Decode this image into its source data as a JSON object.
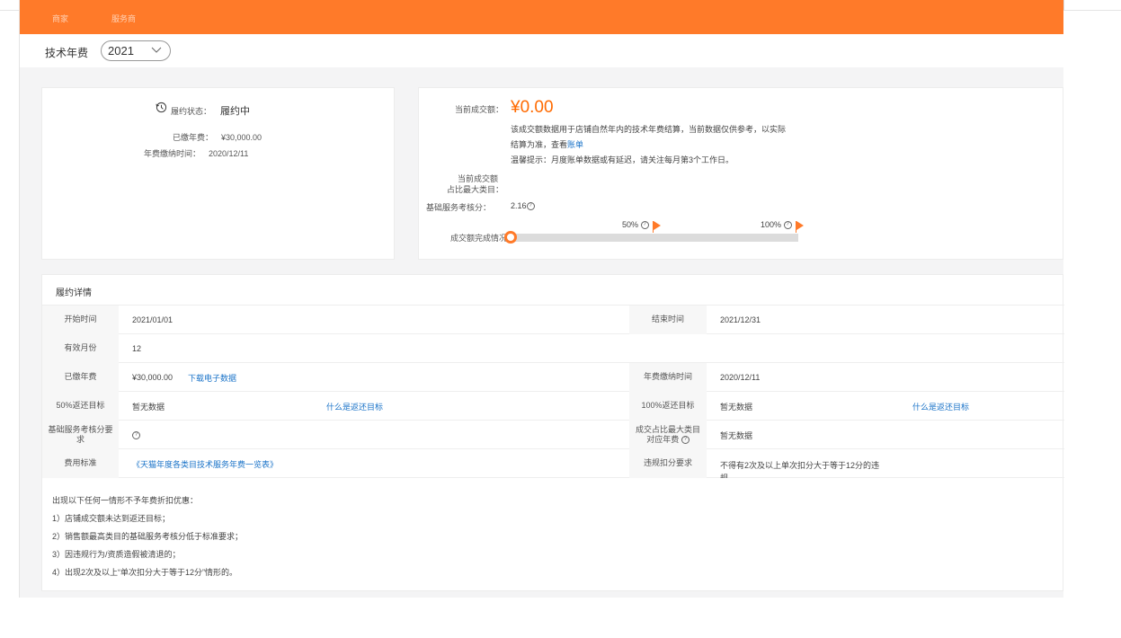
{
  "nav": {
    "item1": "商家",
    "item2": "服务商"
  },
  "title": "技术年费",
  "year_select": {
    "value": "2021"
  },
  "summary": {
    "state_label": "履约状态：",
    "state_value": "履约中",
    "paid_label": "已缴年费：",
    "paid_value": "¥30,000.00",
    "paid_time_label": "年费缴纳时间：",
    "paid_time_value": "2020/12/11"
  },
  "transaction": {
    "current_label": "当前成交额：",
    "current_value": "¥0.00",
    "desc_line1": "该成交额数据用于店铺自然年内的技术年费结算，当前数据仅供参考，以实际",
    "desc_line2_prefix": "结算为准，查看",
    "desc_link": "账单",
    "tip": "温馨提示：月度账单数据或有延迟，请关注每月第3个工作日。",
    "ratio_label_line1": "当前成交额",
    "ratio_label_line2": "占比最大类目：",
    "score_label": "基础服务考核分：",
    "score_value": "2.16",
    "progress_label": "成交额完成情况：",
    "marker_50": "50%",
    "marker_100": "100%",
    "progress_fraction": 0
  },
  "detail": {
    "title": "履约详情",
    "rows": [
      {
        "l1": "开始时间",
        "v1": "2021/01/01",
        "l2": "结束时间",
        "v2": "2021/12/31"
      },
      {
        "l1": "有效月份",
        "v1": "12"
      },
      {
        "l1": "已缴年费",
        "v1": "¥30,000.00",
        "link1": "下载电子数据",
        "l2": "年费缴纳时间",
        "v2": "2020/12/11"
      },
      {
        "l1": "50%返还目标",
        "v1": "暂无数据",
        "link1": "什么是返还目标",
        "l2": "100%返还目标",
        "v2": "暂无数据",
        "link2": "什么是返还目标"
      },
      {
        "l1a": "基础服务考核分要",
        "l1b": "求",
        "l2a": "成交占比最大类目",
        "l2b": "对应年费",
        "v2": "暂无数据"
      },
      {
        "l1": "费用标准",
        "link1": "《天猫年度各类目技术服务年费一览表》",
        "l2": "违规扣分要求",
        "v2a": "不得有2次及以上单次扣分大于等于12分的违",
        "v2b": "规"
      }
    ],
    "notes": [
      "出现以下任何一情形不予年费折扣优惠：",
      "1）店铺成交额未达到返还目标；",
      "2）销售额最高类目的基础服务考核分低于标准要求；",
      "3）因违规行为/资质造假被清退的；",
      "4）出现2次及以上“单次扣分大于等于12分”情形的。"
    ]
  }
}
